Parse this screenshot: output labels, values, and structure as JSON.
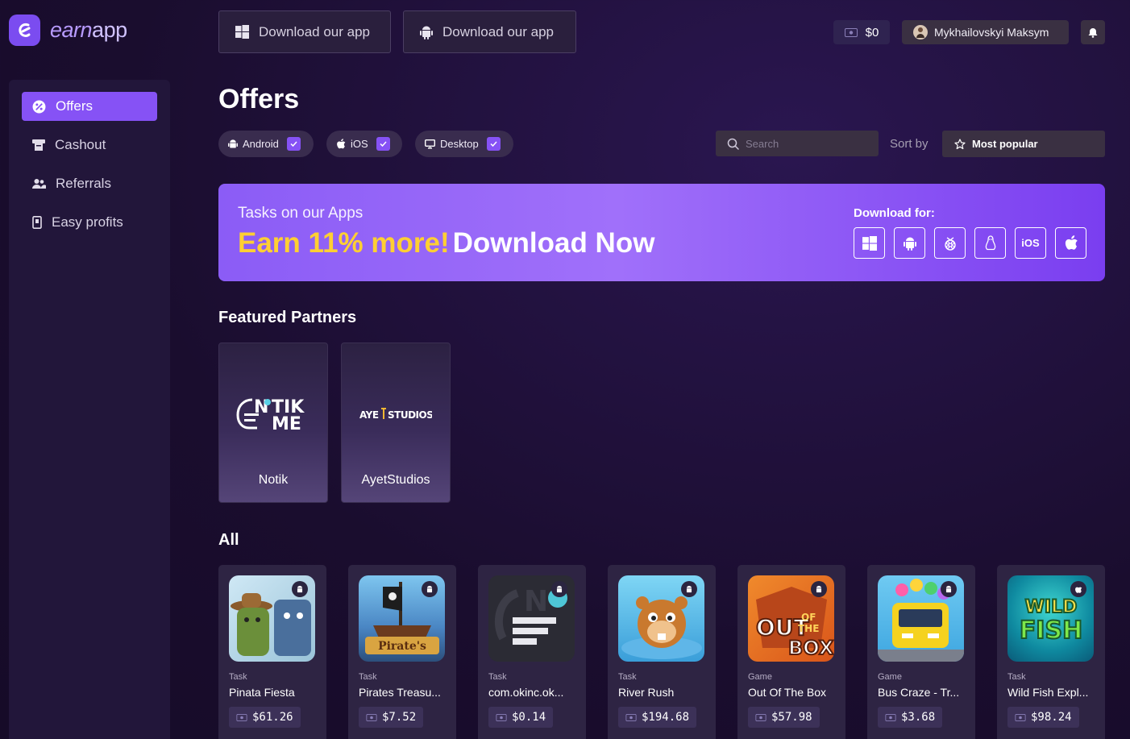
{
  "brand": {
    "logo_text_a": "earn",
    "logo_text_b": "app"
  },
  "topbar": {
    "download_windows": "Download our app",
    "download_android": "Download our app",
    "balance": "$0",
    "user_name": "Mykhailovskyi Maksym"
  },
  "sidebar": {
    "items": [
      {
        "label": "Offers",
        "icon": "offers-icon"
      },
      {
        "label": "Cashout",
        "icon": "cashout-icon"
      },
      {
        "label": "Referrals",
        "icon": "referrals-icon"
      },
      {
        "label": "Easy profits",
        "icon": "easy-profits-icon"
      }
    ]
  },
  "main": {
    "title": "Offers",
    "filters": [
      {
        "label": "Android",
        "checked": true
      },
      {
        "label": "iOS",
        "checked": true
      },
      {
        "label": "Desktop",
        "checked": true
      }
    ],
    "search_placeholder": "Search",
    "sort_label": "Sort by",
    "sort_value": "Most popular"
  },
  "banner": {
    "subtitle": "Tasks on our Apps",
    "highlight": "Earn 11% more!",
    "cta": "Download Now",
    "download_for": "Download for:",
    "platforms": [
      "windows-icon",
      "android-icon",
      "raspberry-pi-icon",
      "linux-icon",
      "iOS",
      "apple-icon"
    ],
    "ios_label": "iOS"
  },
  "featured": {
    "title": "Featured Partners",
    "partners": [
      {
        "name": "Notik",
        "logo_text": "NOTIK ME"
      },
      {
        "name": "AyetStudios",
        "logo_text": "AYET STUDIOS"
      }
    ]
  },
  "all": {
    "title": "All",
    "offers": [
      {
        "type": "Task",
        "title": "Pinata Fiesta",
        "price": "$61.26",
        "platform": "android"
      },
      {
        "type": "Task",
        "title": "Pirates Treasu...",
        "price": "$7.52",
        "platform": "android"
      },
      {
        "type": "Task",
        "title": "com.okinc.ok...",
        "price": "$0.14",
        "platform": "android"
      },
      {
        "type": "Task",
        "title": "River Rush",
        "price": "$194.68",
        "platform": "android"
      },
      {
        "type": "Game",
        "title": "Out Of The Box",
        "price": "$57.98",
        "platform": "android"
      },
      {
        "type": "Game",
        "title": "Bus Craze - Tr...",
        "price": "$3.68",
        "platform": "android"
      },
      {
        "type": "Task",
        "title": "Wild Fish Expl...",
        "price": "$98.24",
        "platform": "apple"
      }
    ]
  },
  "colors": {
    "accent": "#8652f5",
    "highlight": "#ffcf33",
    "background": "#1c1030"
  }
}
